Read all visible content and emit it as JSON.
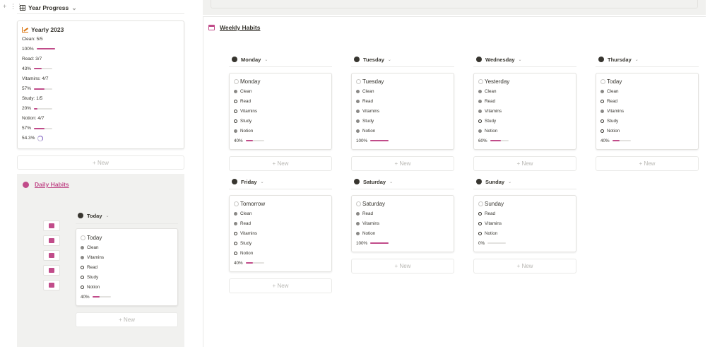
{
  "year_progress": {
    "title": "Year Progress",
    "new_label": "+ New"
  },
  "yearly_card": {
    "title": "Yearly 2023",
    "stats": [
      {
        "label": "Clean: 5/5",
        "percent": "100%",
        "progress": 1.0
      },
      {
        "label": "Read: 3/7",
        "percent": "43%",
        "progress": 0.43
      },
      {
        "label": "Vitamins: 4/7",
        "percent": "57%",
        "progress": 0.57
      },
      {
        "label": "Study: 1/5",
        "percent": "20%",
        "progress": 0.2
      },
      {
        "label": "Notion: 4/7",
        "percent": "57%",
        "progress": 0.57
      }
    ],
    "overall": "54.3%"
  },
  "daily": {
    "title": "Daily Habits",
    "group": "Today",
    "card": {
      "title": "Today",
      "items": [
        {
          "label": "Clean",
          "checked": true
        },
        {
          "label": "Vitamins",
          "checked": true
        },
        {
          "label": "Read",
          "checked": false
        },
        {
          "label": "Study",
          "checked": false
        },
        {
          "label": "Notion",
          "checked": false
        }
      ],
      "percent": "40%",
      "progress": 0.4
    },
    "new_label": "+ New",
    "side_icons": [
      "pen-icon",
      "tag-icon",
      "book-icon",
      "notes-icon",
      "message-icon"
    ]
  },
  "weekly": {
    "title": "Weekly Habits",
    "new_label": "+ New",
    "days": [
      {
        "group": "Monday",
        "card_title": "Monday",
        "items": [
          {
            "label": "Clean",
            "checked": true
          },
          {
            "label": "Read",
            "checked": false
          },
          {
            "label": "Vitamins",
            "checked": false
          },
          {
            "label": "Study",
            "checked": false
          },
          {
            "label": "Notion",
            "checked": true
          }
        ],
        "percent": "40%",
        "progress": 0.4
      },
      {
        "group": "Tuesday",
        "card_title": "Tuesday",
        "items": [
          {
            "label": "Clean",
            "checked": true
          },
          {
            "label": "Read",
            "checked": true
          },
          {
            "label": "Vitamins",
            "checked": true
          },
          {
            "label": "Study",
            "checked": true
          },
          {
            "label": "Notion",
            "checked": true
          }
        ],
        "percent": "100%",
        "progress": 1.0
      },
      {
        "group": "Wednesday",
        "card_title": "Yesterday",
        "items": [
          {
            "label": "Clean",
            "checked": true
          },
          {
            "label": "Read",
            "checked": true
          },
          {
            "label": "Vitamins",
            "checked": true
          },
          {
            "label": "Study",
            "checked": false
          },
          {
            "label": "Notion",
            "checked": true
          }
        ],
        "percent": "60%",
        "progress": 0.6
      },
      {
        "group": "Thursday",
        "card_title": "Today",
        "items": [
          {
            "label": "Clean",
            "checked": true
          },
          {
            "label": "Read",
            "checked": false
          },
          {
            "label": "Vitamins",
            "checked": true
          },
          {
            "label": "Study",
            "checked": false
          },
          {
            "label": "Notion",
            "checked": false
          }
        ],
        "percent": "40%",
        "progress": 0.4
      },
      {
        "group": "Friday",
        "card_title": "Tomorrow",
        "items": [
          {
            "label": "Clean",
            "checked": true
          },
          {
            "label": "Read",
            "checked": true
          },
          {
            "label": "Vitamins",
            "checked": false
          },
          {
            "label": "Study",
            "checked": false
          },
          {
            "label": "Notion",
            "checked": false
          }
        ],
        "percent": "40%",
        "progress": 0.4
      },
      {
        "group": "Saturday",
        "card_title": "Saturday",
        "items": [
          {
            "label": "Read",
            "checked": true
          },
          {
            "label": "Vitamins",
            "checked": true
          },
          {
            "label": "Notion",
            "checked": true
          }
        ],
        "percent": "100%",
        "progress": 1.0
      },
      {
        "group": "Sunday",
        "card_title": "Sunday",
        "items": [
          {
            "label": "Read",
            "checked": false
          },
          {
            "label": "Vitamins",
            "checked": false
          },
          {
            "label": "Notion",
            "checked": false
          }
        ],
        "percent": "0%",
        "progress": 0.0
      }
    ]
  },
  "colors": {
    "accent": "#c14c8a",
    "text": "#37352f",
    "panel": "#f1f1ef"
  }
}
